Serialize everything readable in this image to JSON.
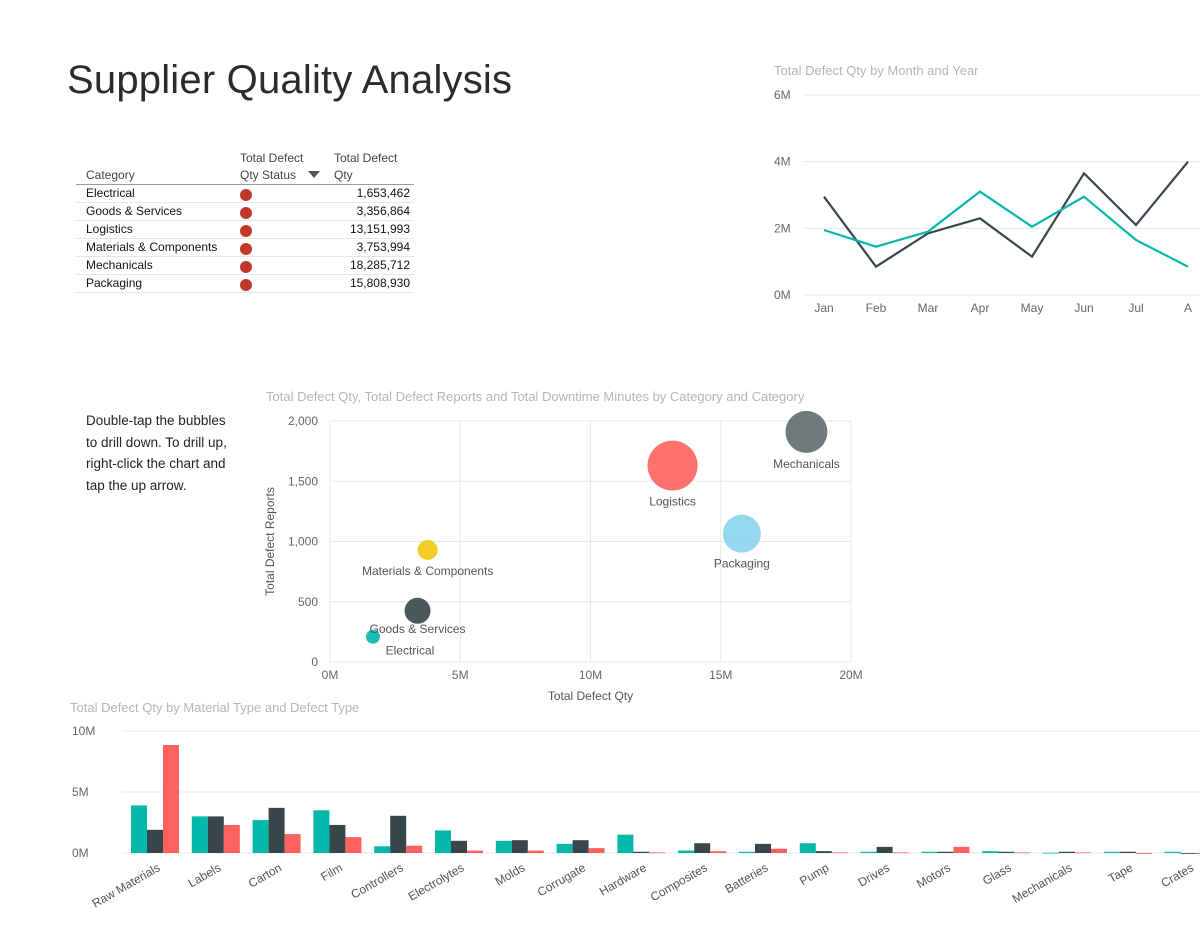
{
  "page": {
    "title": "Supplier Quality Analysis"
  },
  "status_table": {
    "headers": {
      "category": "Category",
      "status_line1": "Total Defect",
      "status_line2": "Qty Status",
      "qty_line1": "Total Defect",
      "qty_line2": "Qty"
    },
    "rows": [
      {
        "category": "Electrical",
        "qty": "1,653,462"
      },
      {
        "category": "Goods & Services",
        "qty": "3,356,864"
      },
      {
        "category": "Logistics",
        "qty": "13,151,993"
      },
      {
        "category": "Materials & Components",
        "qty": "3,753,994"
      },
      {
        "category": "Mechanicals",
        "qty": "18,285,712"
      },
      {
        "category": "Packaging",
        "qty": "15,808,930"
      }
    ],
    "status_color": "#c0392b"
  },
  "hint": {
    "text": "Double-tap the bubbles to drill down. To drill up, right-click the chart and tap the up arrow."
  },
  "chart_data": [
    {
      "type": "line",
      "title": "Total Defect Qty by Month and Year",
      "x": [
        "Jan",
        "Feb",
        "Mar",
        "Apr",
        "May",
        "Jun",
        "Jul",
        "A"
      ],
      "ylim": [
        0,
        6
      ],
      "yticks": [
        "0M",
        "2M",
        "4M",
        "6M"
      ],
      "series": [
        {
          "values": [
            2.95,
            0.85,
            1.85,
            2.3,
            1.15,
            3.65,
            2.1,
            4.0
          ],
          "color": "#374649"
        },
        {
          "values": [
            1.95,
            1.45,
            1.9,
            3.1,
            2.05,
            2.95,
            1.65,
            0.85
          ],
          "color": "#01b8aa"
        }
      ],
      "grid": true
    },
    {
      "type": "scatter",
      "title": "Total Defect Qty, Total Defect Reports and Total Downtime Minutes by Category and Category",
      "xlabel": "Total Defect Qty",
      "ylabel": "Total Defect Reports",
      "xlim": [
        0,
        20
      ],
      "ylim": [
        0,
        2000
      ],
      "xticks": [
        "0M",
        "5M",
        "10M",
        "15M",
        "20M"
      ],
      "yticks": [
        "0",
        "500",
        "1,000",
        "1,500",
        "2,000"
      ],
      "points": [
        {
          "label": "Electrical",
          "x": 1.65,
          "y": 210,
          "size": 7,
          "color": "#01b8aa"
        },
        {
          "label": "Goods & Services",
          "x": 3.36,
          "y": 425,
          "size": 13,
          "color": "#374649"
        },
        {
          "label": "Materials & Components",
          "x": 3.75,
          "y": 930,
          "size": 10,
          "color": "#f2c80f"
        },
        {
          "label": "Logistics",
          "x": 13.15,
          "y": 1630,
          "size": 25,
          "color": "#fd625e"
        },
        {
          "label": "Packaging",
          "x": 15.81,
          "y": 1065,
          "size": 19,
          "color": "#8ad4eb"
        },
        {
          "label": "Mechanicals",
          "x": 18.29,
          "y": 1910,
          "size": 21,
          "color": "#5f6b6d"
        }
      ],
      "grid": true
    },
    {
      "type": "bar",
      "title": "Total Defect Qty by Material Type and Defect Type",
      "categories": [
        "Raw Materials",
        "Labels",
        "Carton",
        "Film",
        "Controllers",
        "Electrolytes",
        "Molds",
        "Corrugate",
        "Hardware",
        "Composites",
        "Batteries",
        "Pump",
        "Drives",
        "Motors",
        "Glass",
        "Mechanicals",
        "Tape",
        "Crates"
      ],
      "ylim": [
        0,
        10
      ],
      "yticks": [
        "0M",
        "5M",
        "10M"
      ],
      "series": [
        {
          "color": "#01b8aa",
          "values": [
            3.9,
            3.0,
            2.7,
            3.5,
            0.55,
            1.85,
            1.0,
            0.75,
            1.5,
            0.2,
            0.1,
            0.8,
            0.1,
            0.1,
            0.15,
            0.02,
            0.1,
            0.1
          ]
        },
        {
          "color": "#374649",
          "values": [
            1.9,
            3.0,
            3.7,
            2.3,
            3.05,
            1.0,
            1.05,
            1.05,
            0.1,
            0.8,
            0.75,
            0.15,
            0.5,
            0.1,
            0.1,
            0.1,
            0.1,
            0.0
          ]
        },
        {
          "color": "#fd625e",
          "values": [
            8.85,
            2.3,
            1.55,
            1.3,
            0.6,
            0.2,
            0.2,
            0.4,
            0.05,
            0.15,
            0.35,
            0.05,
            0.05,
            0.5,
            0.05,
            0.05,
            0.0,
            0.0
          ]
        }
      ],
      "grid": true
    }
  ]
}
